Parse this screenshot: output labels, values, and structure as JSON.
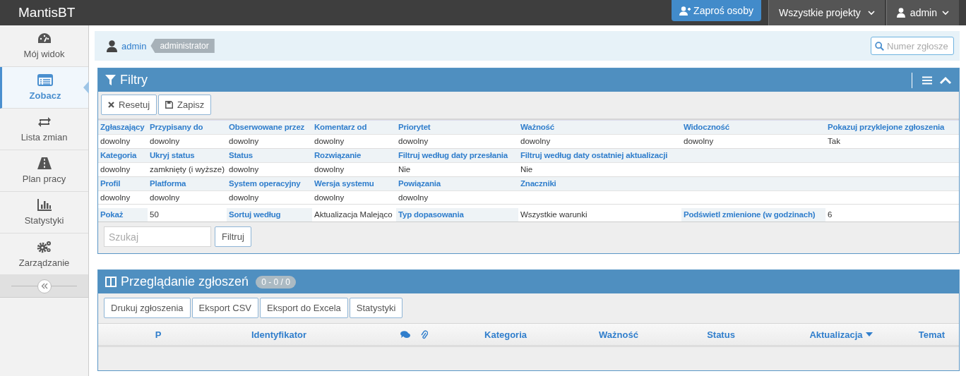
{
  "app": {
    "title": "MantisBT"
  },
  "topbar": {
    "invite_button": "Zaproś osoby",
    "project_menu": "Wszystkie projekty",
    "user_menu": "admin"
  },
  "sidebar": {
    "items": [
      {
        "label": "Mój widok",
        "selected": false
      },
      {
        "label": "Zobacz",
        "selected": true
      },
      {
        "label": "Lista zmian",
        "selected": false
      },
      {
        "label": "Plan pracy",
        "selected": false
      },
      {
        "label": "Statystyki",
        "selected": false
      },
      {
        "label": "Zarządzanie",
        "selected": false
      }
    ]
  },
  "breadcrumb": {
    "user": "admin",
    "role": "administrator",
    "search_placeholder": "Numer zgłosze"
  },
  "filters": {
    "title": "Filtry",
    "buttons": [
      "Resetuj",
      "Zapisz"
    ],
    "groups": [
      {
        "fields": [
          {
            "label": "Zgłaszający",
            "value": "dowolny"
          },
          {
            "label": "Przypisany do",
            "value": "dowolny"
          },
          {
            "label": "Obserwowane przez",
            "value": "dowolny"
          },
          {
            "label": "Komentarz od",
            "value": "dowolny"
          },
          {
            "label": "Priorytet",
            "value": "dowolny"
          },
          {
            "label": "Ważność",
            "value": "dowolny"
          },
          {
            "label": "Widoczność",
            "value": "dowolny"
          },
          {
            "label": "Pokazuj przyklejone zgłoszenia",
            "value": "Tak"
          }
        ]
      },
      {
        "fields": [
          {
            "label": "Kategoria",
            "value": "dowolny"
          },
          {
            "label": "Ukryj status",
            "value": "zamknięty (i wyższe)"
          },
          {
            "label": "Status",
            "value": "dowolny"
          },
          {
            "label": "Rozwiązanie",
            "value": "dowolny"
          },
          {
            "label": "Filtruj według daty przesłania",
            "value": "Nie"
          },
          {
            "label": "Filtruj według daty ostatniej aktualizacji",
            "value": "Nie"
          }
        ]
      },
      {
        "fields": [
          {
            "label": "Profil",
            "value": "dowolny"
          },
          {
            "label": "Platforma",
            "value": "dowolny"
          },
          {
            "label": "System operacyjny",
            "value": "dowolny"
          },
          {
            "label": "Wersja systemu",
            "value": "dowolny"
          },
          {
            "label": "Powiązania",
            "value": "dowolny"
          },
          {
            "label": "Znaczniki"
          }
        ]
      }
    ],
    "options": [
      {
        "label": "Pokaż",
        "value": "50"
      },
      {
        "label": "Sortuj według",
        "value": "Aktualizacja Malejąco"
      },
      {
        "label": "Typ dopasowania",
        "value": "Wszystkie warunki"
      },
      {
        "label": "Podświetl zmienione (w godzinach)",
        "value": "6"
      }
    ],
    "search_placeholder": "Szukaj",
    "filter_button": "Filtruj"
  },
  "issues": {
    "title": "Przeglądanie zgłoszeń",
    "count": "0 - 0 / 0",
    "buttons": [
      "Drukuj zgłoszenia",
      "Eksport CSV",
      "Eksport do Excela",
      "Statystyki"
    ],
    "columns": [
      {
        "kind": "text",
        "label": "P",
        "sorted": false
      },
      {
        "kind": "text",
        "label": "Identyfikator",
        "sorted": false
      },
      {
        "kind": "comments"
      },
      {
        "kind": "attachments"
      },
      {
        "kind": "text",
        "label": "Kategoria",
        "sorted": false
      },
      {
        "kind": "text",
        "label": "Ważność",
        "sorted": false
      },
      {
        "kind": "text",
        "label": "Status",
        "sorted": false
      },
      {
        "kind": "text",
        "label": "Aktualizacja",
        "sorted": true
      },
      {
        "kind": "text",
        "label": "Temat",
        "sorted": false
      }
    ]
  }
}
